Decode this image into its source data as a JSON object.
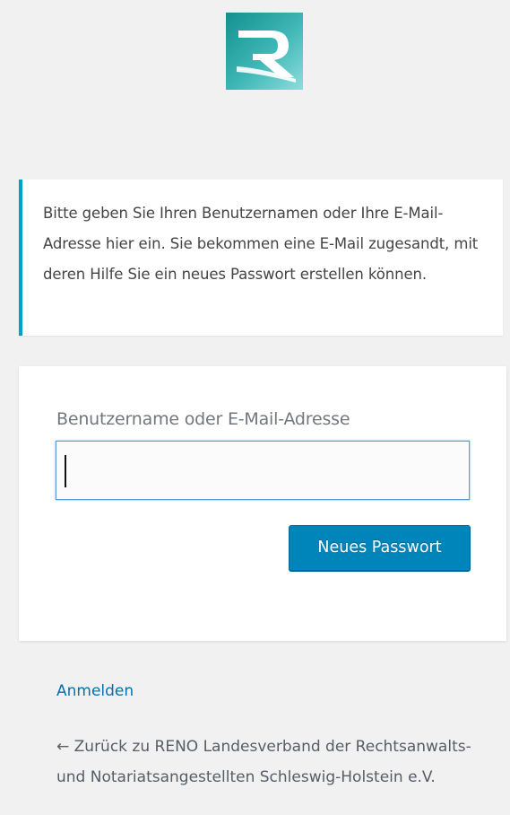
{
  "logo": {
    "icon": "reno-r-logo-icon",
    "alt": "RENO",
    "colors": {
      "gradient_start": "#1a9e9e",
      "gradient_end": "#7fd6d6",
      "letter": "#ffffff"
    }
  },
  "message": {
    "text": "Bitte geben Sie Ihren Benutzernamen oder Ihre E-Mail-Adresse hier ein. Sie bekommen eine E-Mail zugesandt, mit deren Hilfe Sie ein neues Passwort erstellen können.",
    "accent_color": "#00a0d2"
  },
  "form": {
    "field_label": "Benutzername oder E-Mail-Adresse",
    "field_value": "",
    "submit_label": "Neues Passwort",
    "button_color": "#0085ba"
  },
  "nav": {
    "login_link": "Anmelden",
    "back_link": "← Zurück zu RENO Landesverband der Rechtsanwalts- und Notariatsangestellten Schleswig-Holstein e.V."
  }
}
